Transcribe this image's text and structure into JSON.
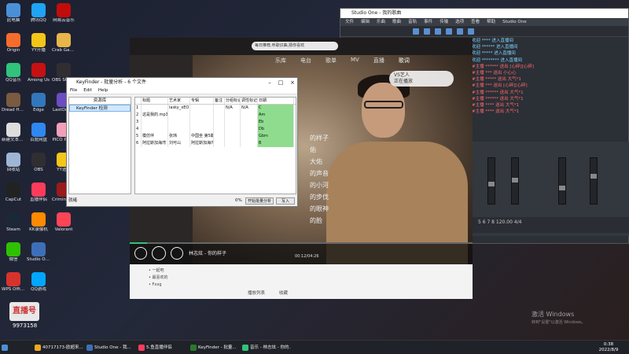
{
  "desktop_icons": [
    {
      "label": "此电脑",
      "color": "#4a90d9"
    },
    {
      "label": "Origin",
      "color": "#f56c2d"
    },
    {
      "label": "QQ音乐",
      "color": "#31c27c"
    },
    {
      "label": "Dread Hunger",
      "color": "#7a5a40"
    },
    {
      "label": "新建文本文档",
      "color": "#dddddd"
    },
    {
      "label": "回收站",
      "color": "#9fb5d4"
    },
    {
      "label": "CapCut",
      "color": "#222222"
    },
    {
      "label": "Steam",
      "color": "#1b2838"
    },
    {
      "label": "微信",
      "color": "#2dc100"
    },
    {
      "label": "WPS Office",
      "color": "#d8322d"
    },
    {
      "label": "腾讯QQ",
      "color": "#1fa3f5"
    },
    {
      "label": "YY开播",
      "color": "#f5c518"
    },
    {
      "label": "Among Us",
      "color": "#c51111"
    },
    {
      "label": "Edge",
      "color": "#3277bc"
    },
    {
      "label": "百度网盘",
      "color": "#2e88f0"
    },
    {
      "label": "OBS",
      "color": "#302e31"
    },
    {
      "label": "直播伴侣",
      "color": "#ff3b5c"
    },
    {
      "label": "KK录像机",
      "color": "#ff8a00"
    },
    {
      "label": "Studio One",
      "color": "#3d6fb8"
    },
    {
      "label": "QQ游戏",
      "color": "#00a6ff"
    },
    {
      "label": "网易云音乐",
      "color": "#c20c0c"
    },
    {
      "label": "Crab Game",
      "color": "#e8b54a"
    },
    {
      "label": "OBS Studio",
      "color": "#302e31"
    },
    {
      "label": "LastOrigin",
      "color": "#6b4cc2"
    },
    {
      "label": "PICO PARK",
      "color": "#f2a0b8"
    },
    {
      "label": "YY语音",
      "color": "#f5c518"
    },
    {
      "label": "Criminal Party",
      "color": "#9a1b1b"
    },
    {
      "label": "Valorant",
      "color": "#fd4556"
    }
  ],
  "daw": {
    "title": "Studio One - 我的歌曲",
    "menu": [
      "文件",
      "编辑",
      "乐曲",
      "歌曲",
      "音轨",
      "事件",
      "传输",
      "选项",
      "查看",
      "帮助",
      "Studio One"
    ],
    "status": "5   6   7   8   120.00   4/4"
  },
  "chat_messages": [
    "欢迎 **** 进入直播间",
    "欢迎 ****** 进入直播间",
    "欢迎 ***** 进入直播间",
    "欢迎 ******** 进入直播间",
    "#主播 ****** 送出 [心碎][心碎]",
    "#主播 *** 送出 小心心",
    "#主播 ***** 送出 大气*1",
    "#主播 *** 送出 [心碎][心碎]",
    "#主播 ****** 送出 大气*1",
    "#主播 ****** 送出 大气*1",
    "#主播 **** 送出 大气*1",
    "#主播 **** 送出 大气*1"
  ],
  "player": {
    "search_placeholder": "每日推荐,听歌识曲,猜你喜欢",
    "nav": [
      "乐库",
      "电台",
      "歌单",
      "MV",
      "直播",
      "歌词"
    ],
    "active_nav": "歌词",
    "badge_line1": "VS艺人",
    "badge_line2": "正在播放",
    "lyrics": [
      "的样子",
      "佑",
      "大佑",
      "的声音",
      "的小河",
      "的步伐",
      "的眼神",
      "的脸"
    ],
    "track_name": "林志炫 - 你的样子",
    "track_time": "00:12/04:26",
    "progress": 0.05,
    "bottom_list": [
      "一起吧",
      "最喜欢的",
      "Fxxg"
    ],
    "bottom_bar": [
      "播放列表",
      "收藏"
    ]
  },
  "keyfinder": {
    "title": "KeyFinder - 批量分析 - 6 个文件",
    "menu": [
      "File",
      "Edit",
      "Help"
    ],
    "library_header": "资源库",
    "library_item": "KeyFinder 检测",
    "columns": [
      "",
      "标题",
      "艺术家",
      "专辑",
      "备注",
      "分组标记",
      "调性标记",
      "日期"
    ],
    "rows": [
      {
        "n": "1",
        "title": "",
        "artist": "lasky_xEO",
        "album": "",
        "comment": "",
        "grouping": "N/A",
        "keytag": "N/A",
        "key": "C"
      },
      {
        "n": "2",
        "title": "这是我的.mp3",
        "artist": "",
        "album": "",
        "comment": "",
        "grouping": "",
        "keytag": "",
        "key": "Am"
      },
      {
        "n": "3",
        "title": "",
        "artist": "",
        "album": "",
        "comment": "",
        "grouping": "",
        "keytag": "",
        "key": "Eb"
      },
      {
        "n": "4",
        "title": "",
        "artist": "",
        "album": "",
        "comment": "",
        "grouping": "",
        "keytag": "",
        "key": "Db"
      },
      {
        "n": "5",
        "title": "模仿伴",
        "artist": "张玮",
        "album": "中国坐 第5期",
        "comment": "",
        "grouping": "",
        "keytag": "",
        "key": "Gbm"
      },
      {
        "n": "6",
        "title": "阿拉斯加海湾",
        "artist": "刘可山",
        "album": "阿拉斯加海湾",
        "comment": "",
        "grouping": "",
        "keytag": "",
        "key": "B"
      }
    ],
    "status_left": "就绪",
    "status_pct": "0%",
    "btn_analyze": "开始批量分析",
    "btn_write": "写入"
  },
  "streamer": {
    "logo": "直播号",
    "id": "9973158"
  },
  "watermark": {
    "line1": "激活 Windows",
    "line2": "转到\"设置\"以激活 Windows。"
  },
  "taskbar": {
    "items": [
      {
        "label": "40717173-欧超来...",
        "color": "#f5a623"
      },
      {
        "label": "Studio One - 我...",
        "color": "#3d6fb8"
      },
      {
        "label": "5.鱼直播伴侣",
        "color": "#ff3b5c"
      },
      {
        "label": "KeyFinder - 批量...",
        "color": "#2a7a2a"
      },
      {
        "label": "音乐 - 林志炫 - 你的...",
        "color": "#31c27c"
      }
    ],
    "time": "0:38",
    "date": "2022/8/9"
  }
}
